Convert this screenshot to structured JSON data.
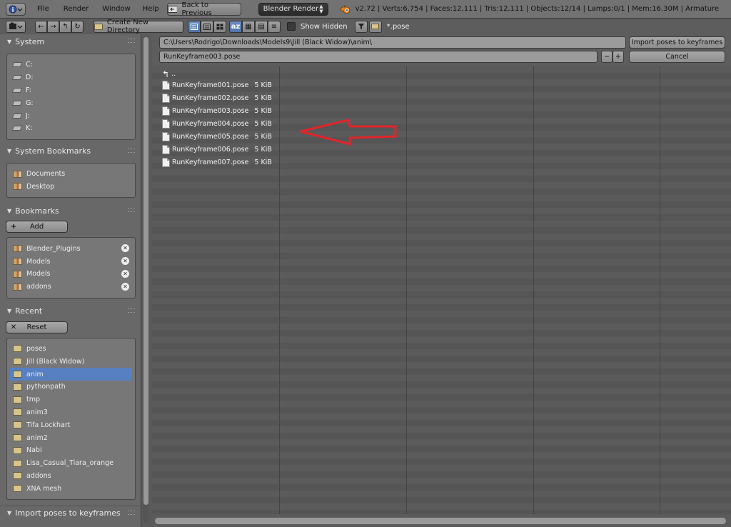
{
  "infobar": {
    "info_icon": "info-icon",
    "menus": [
      "File",
      "Render",
      "Window",
      "Help"
    ],
    "back_button": "Back to Previous",
    "render_engine": "Blender Render",
    "blender_logo": "blender-logo-icon",
    "stats": "v2.72 | Verts:6,754 | Faces:12,111 | Tris:12,111 | Objects:12/14 | Lamps:0/1 | Mem:16.30M | Armature"
  },
  "toolbar": {
    "create_dir": "Create New Directory",
    "show_hidden": "Show Hidden",
    "filter_glob": "*.pose"
  },
  "sidebar": {
    "system_title": "System",
    "drives": [
      "C:",
      "D:",
      "F:",
      "G:",
      "J:",
      "K:"
    ],
    "sys_bookmarks_title": "System Bookmarks",
    "sys_bookmarks": [
      "Documents",
      "Desktop"
    ],
    "bookmarks_title": "Bookmarks",
    "add_label": "Add",
    "bookmarks": [
      "Blender_Plugins",
      "Models",
      "Models",
      "addons"
    ],
    "recent_title": "Recent",
    "reset_label": "Reset",
    "recent": [
      "poses",
      "Jill (Black Widow)",
      "anim",
      "pythonpath",
      "tmp",
      "anim3",
      "Tifa Lockhart",
      "anim2",
      "Nabi",
      "Lisa_Casual_Tiara_orange",
      "addons",
      "XNA mesh"
    ],
    "recent_selected": "anim",
    "operator_title": "Import poses to keyframes"
  },
  "main": {
    "path": "C:\\Users\\Rodrigo\\Downloads\\Models9\\Jill (Black Widow)\\anim\\",
    "filename": "RunKeyframe003.pose",
    "import_button": "Import poses to keyframes",
    "cancel_button": "Cancel",
    "parent_dir": "..",
    "files": [
      {
        "name": "RunKeyframe001.pose",
        "size": "5 KiB"
      },
      {
        "name": "RunKeyframe002.pose",
        "size": "5 KiB"
      },
      {
        "name": "RunKeyframe003.pose",
        "size": "5 KiB"
      },
      {
        "name": "RunKeyframe004.pose",
        "size": "5 KiB"
      },
      {
        "name": "RunKeyframe005.pose",
        "size": "5 KiB"
      },
      {
        "name": "RunKeyframe006.pose",
        "size": "5 KiB"
      },
      {
        "name": "RunKeyframe007.pose",
        "size": "5 KiB"
      }
    ],
    "annotation_arrow_color": "#e0252a"
  }
}
